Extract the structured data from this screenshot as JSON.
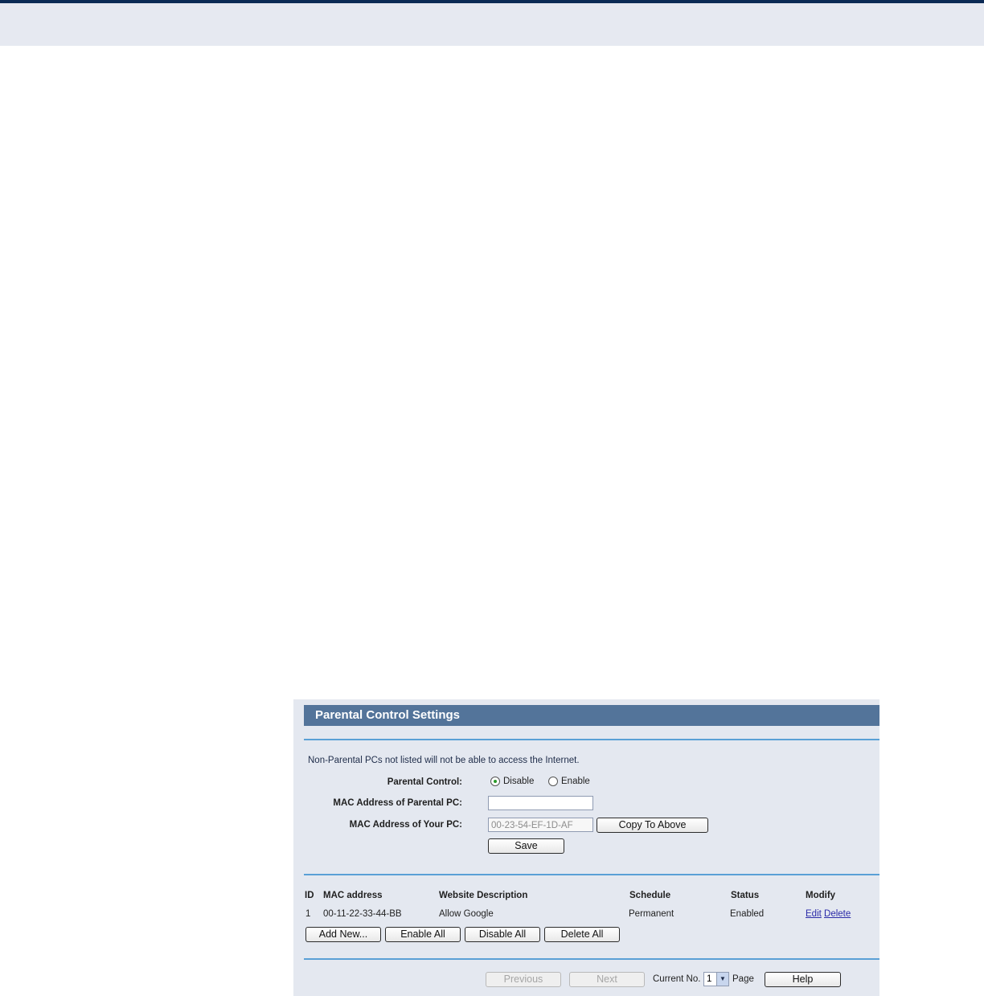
{
  "panel": {
    "title": "Parental Control Settings",
    "note": "Non-Parental PCs not listed will not be able to access the Internet.",
    "parental_control_label": "Parental Control:",
    "radio_disable": "Disable",
    "radio_enable": "Enable",
    "selected": "Disable",
    "mac_parental_label": "MAC Address of Parental PC:",
    "mac_parental_value": "",
    "mac_your_label": "MAC Address of Your PC:",
    "mac_your_value": "00-23-54-EF-1D-AF",
    "copy_button": "Copy To Above",
    "save_button": "Save"
  },
  "table": {
    "headers": [
      "ID",
      "MAC address",
      "Website Description",
      "Schedule",
      "Status",
      "Modify"
    ],
    "rows": [
      {
        "id": "1",
        "mac": "00-11-22-33-44-BB",
        "desc": "Allow Google",
        "schedule": "Permanent",
        "status": "Enabled",
        "edit": "Edit",
        "delete": "Delete"
      }
    ]
  },
  "actions": {
    "add_new": "Add New...",
    "enable_all": "Enable All",
    "disable_all": "Disable All",
    "delete_all": "Delete All"
  },
  "pager": {
    "previous": "Previous",
    "next": "Next",
    "current_no_label": "Current No.",
    "current_page": "1",
    "page_label": "Page",
    "help": "Help"
  }
}
